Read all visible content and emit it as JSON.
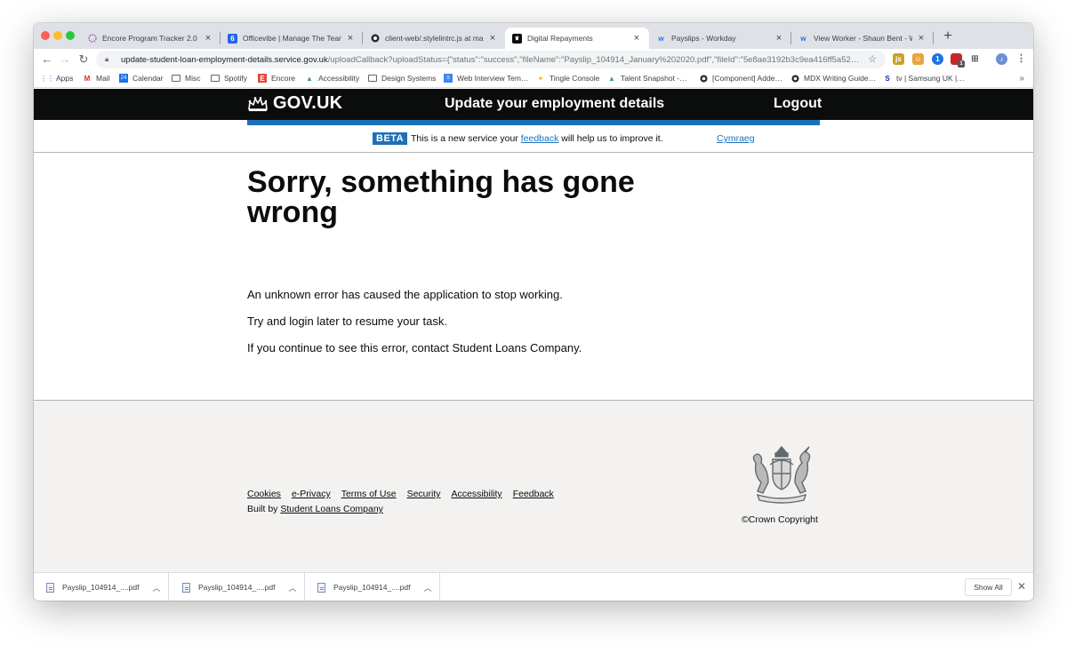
{
  "browser": {
    "tabs": [
      {
        "title": "Encore Program Tracker 2.0",
        "icon": "encore-circle-icon",
        "active": false
      },
      {
        "title": "Officevibe | Manage The Team E…",
        "icon": "officevibe-icon",
        "active": false
      },
      {
        "title": "client-web/.stylelintrc.js at mast…",
        "icon": "github-icon",
        "active": false
      },
      {
        "title": "Digital Repayments",
        "icon": "govuk-icon",
        "active": true
      },
      {
        "title": "Payslips - Workday",
        "icon": "workday-icon",
        "active": false
      },
      {
        "title": "View Worker - Shaun Bent - Wo…",
        "icon": "workday-icon",
        "active": false
      }
    ],
    "url_host": "update-student-loan-employment-details.service.gov.uk",
    "url_path": "/uploadCallback?uploadStatus={\"status\":\"success\",\"fileName\":\"Payslip_104914_January%202020.pdf\",\"fileId\":\"5e8ae3192b3c9ea416ff5a52…",
    "ext_badge": "1",
    "bookmarks": [
      {
        "label": "Apps",
        "icon": "apps-grid-icon"
      },
      {
        "label": "Mail",
        "icon": "gmail-icon"
      },
      {
        "label": "Calendar",
        "icon": "calendar-icon"
      },
      {
        "label": "Misc",
        "icon": "folder-icon"
      },
      {
        "label": "Spotify",
        "icon": "folder-icon"
      },
      {
        "label": "Encore",
        "icon": "encore-icon"
      },
      {
        "label": "Accessibility",
        "icon": "drive-icon"
      },
      {
        "label": "Design Systems",
        "icon": "folder-icon"
      },
      {
        "label": "Web Interview Tem…",
        "icon": "docs-icon"
      },
      {
        "label": "Tingle Console",
        "icon": "sparkle-icon"
      },
      {
        "label": "Talent Snapshot -…",
        "icon": "drive-icon"
      },
      {
        "label": "[Component] Adde…",
        "icon": "github-icon"
      },
      {
        "label": "MDX Writing Guide…",
        "icon": "github-icon"
      },
      {
        "label": "tv | Samsung UK |…",
        "icon": "samsung-icon"
      }
    ]
  },
  "header": {
    "logo_text": "GOV.UK",
    "service_name": "Update your employment details",
    "logout": "Logout"
  },
  "phase_banner": {
    "tag": "BETA",
    "text_before": "This is a new service your ",
    "link": "feedback",
    "text_after": " will help us to improve it.",
    "language_link": "Cymraeg"
  },
  "main": {
    "title": "Sorry, something has gone wrong",
    "paragraphs": [
      "An unknown error has caused the application to stop working.",
      "Try and login later to resume your task.",
      "If you continue to see this error, contact Student Loans Company."
    ]
  },
  "footer": {
    "links": [
      "Cookies",
      "e-Privacy",
      "Terms of Use",
      "Security",
      "Accessibility",
      "Feedback"
    ],
    "built_by_prefix": "Built by ",
    "built_by_link": "Student Loans Company",
    "copyright": "©Crown Copyright"
  },
  "downloads": {
    "files": [
      "Payslip_104914_....pdf",
      "Payslip_104914_....pdf",
      "Payslip_104914_....pdf"
    ],
    "show_all": "Show All"
  },
  "colors": {
    "header_bg": "#0b0c0c",
    "brand_blue": "#1d70b8",
    "footer_bg": "#f3f2f1"
  }
}
